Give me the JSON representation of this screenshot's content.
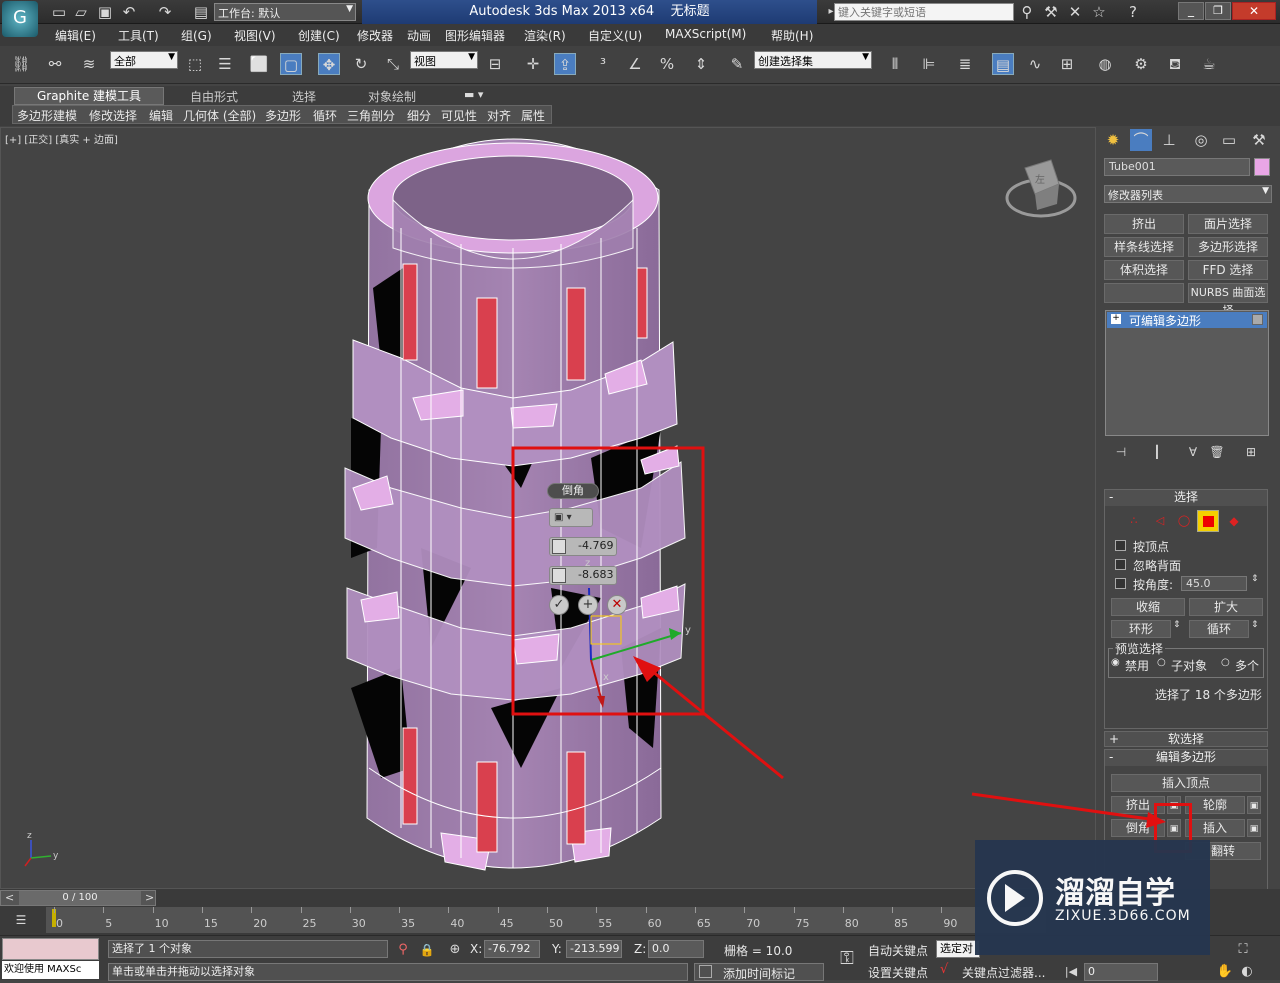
{
  "title": {
    "workspace_label": "工作台: 默认",
    "app_name": "Autodesk 3ds Max  2013 x64",
    "doc_name": "无标题",
    "search_placeholder": "键入关键字或短语"
  },
  "menu": [
    "编辑(E)",
    "工具(T)",
    "组(G)",
    "视图(V)",
    "创建(C)",
    "修改器",
    "动画",
    "图形编辑器",
    "渲染(R)",
    "自定义(U)",
    "MAXScript(M)",
    "帮助(H)"
  ],
  "toolbar": {
    "filter_value": "全部",
    "refcoord_value": "视图",
    "named_selection_value": "创建选择集"
  },
  "ribbon": {
    "tabs": [
      "Graphite 建模工具",
      "自由形式",
      "选择",
      "对象绘制"
    ],
    "panels": [
      "多边形建模",
      "修改选择",
      "编辑",
      "几何体 (全部)",
      "多边形",
      "循环",
      "三角剖分",
      "细分",
      "可见性",
      "对齐",
      "属性"
    ]
  },
  "viewport": {
    "label": "[+] [正交] [真实 + 边面]",
    "viewcube_label": "左",
    "caddy": {
      "title": "倒角",
      "height_value": "-4.769",
      "outline_value": "-8.683"
    },
    "gizmo_axes": {
      "x": "x",
      "y": "y",
      "z": "z"
    }
  },
  "command_panel": {
    "object_name": "Tube001",
    "object_color": "#e9a6e6",
    "modifier_list": "修改器列表",
    "modifier_buttons": [
      "挤出",
      "面片选择",
      "样条线选择",
      "多边形选择",
      "体积选择",
      "FFD 选择",
      "",
      "NURBS 曲面选择"
    ],
    "stack_item": "可编辑多边形",
    "selection": {
      "header": "选择",
      "by_vertex": "按顶点",
      "ignore_backface": "忽略背面",
      "by_angle": "按角度:",
      "angle_value": "45.0",
      "shrink": "收缩",
      "grow": "扩大",
      "ring": "环形",
      "loop": "循环",
      "preview_header": "预览选择",
      "preview_options": [
        "禁用",
        "子对象",
        "多个"
      ],
      "status": "选择了 18 个多边形"
    },
    "soft_selection": "软选择",
    "edit_polygons": {
      "header": "编辑多边形",
      "insert_vertex": "插入顶点",
      "extrude": "挤出",
      "outline": "轮廓",
      "bevel": "倒角",
      "inset": "插入",
      "flip": "翻转"
    }
  },
  "timeline": {
    "frame_range": "0 / 100",
    "ticks": [
      "0",
      "5",
      "10",
      "15",
      "20",
      "25",
      "30",
      "35",
      "40",
      "45",
      "50",
      "55",
      "60",
      "65",
      "70",
      "75",
      "80",
      "85",
      "90"
    ]
  },
  "status": {
    "welcome": "欢迎使用 MAXSc",
    "selected": "选择了 1 个对象",
    "prompt": "单击或单击并拖动以选择对象",
    "x_label": "X:",
    "x_value": "-76.792",
    "y_label": "Y:",
    "y_value": "-213.599",
    "z_label": "Z:",
    "z_value": "0.0",
    "grid": "栅格 = 10.0",
    "auto_key": "自动关键点",
    "set_key": "设置关键点",
    "selected_dropdown": "选定对",
    "key_filters": "关键点过滤器...",
    "add_time_tag": "添加时间标记",
    "frame_value": "0"
  },
  "watermark": {
    "brand": "溜溜自学",
    "url": "ZIXUE.3D66.COM"
  },
  "colors": {
    "tube_face": "#9a77a8",
    "tube_light": "#e3aee6",
    "selected_poly": "#d9404e",
    "annotation_red": "#e01010",
    "watermark_bg": "#26364f"
  }
}
